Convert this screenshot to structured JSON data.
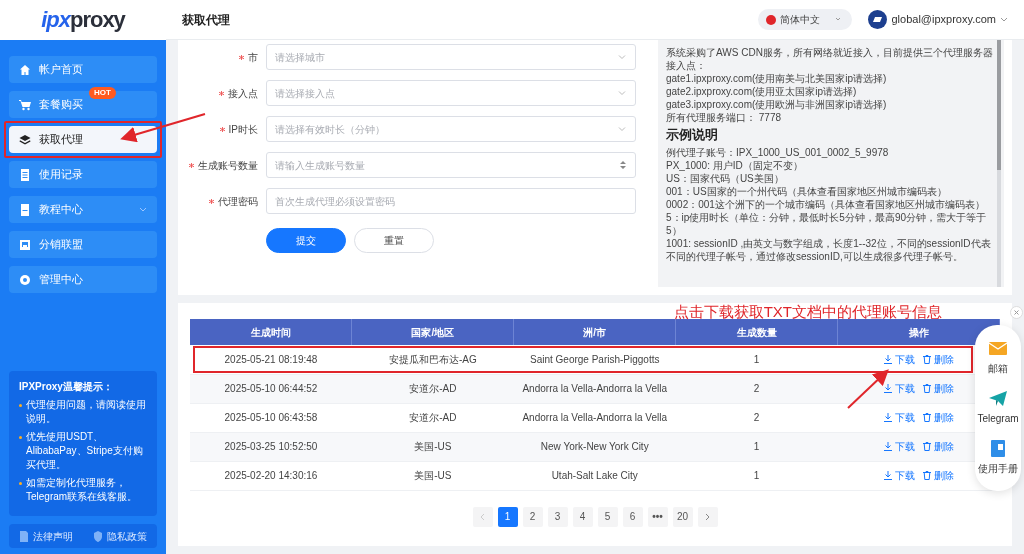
{
  "logo": {
    "mark": "ipx",
    "name": "proxy"
  },
  "sidebar": {
    "items": [
      {
        "label": "帐户首页",
        "selected": false,
        "annotated": false,
        "has_submenu": false
      },
      {
        "label": "套餐购买",
        "selected": false,
        "annotated": false,
        "has_submenu": false,
        "badge": "HOT"
      },
      {
        "label": "获取代理",
        "selected": true,
        "annotated": true,
        "has_submenu": false
      },
      {
        "label": "使用记录",
        "selected": false,
        "annotated": false,
        "has_submenu": false
      },
      {
        "label": "教程中心",
        "selected": false,
        "annotated": false,
        "has_submenu": true
      },
      {
        "label": "分销联盟",
        "selected": false,
        "annotated": false,
        "has_submenu": false
      },
      {
        "label": "管理中心",
        "selected": false,
        "annotated": false,
        "has_submenu": false
      }
    ],
    "tips": {
      "title": "IPXProxy温馨提示：",
      "items": [
        "代理使用问题，请阅读使用说明。",
        "优先使用USDT、AlibabaPay、Stripe支付购买代理。",
        "如需定制化代理服务，Telegram联系在线客服。"
      ]
    },
    "footer_links": [
      "法律声明",
      "隐私政策"
    ]
  },
  "header": {
    "title": "获取代理",
    "language": "简体中文",
    "user": "global@ipxproxy.com"
  },
  "form": {
    "fields": [
      {
        "label": "市",
        "required": true,
        "kind": "select",
        "placeholder": "请选择城市"
      },
      {
        "label": "接入点",
        "required": true,
        "kind": "select",
        "placeholder": "请选择接入点"
      },
      {
        "label": "IP时长",
        "required": true,
        "kind": "select",
        "placeholder": "请选择有效时长（分钟）"
      },
      {
        "label": "生成账号数量",
        "required": true,
        "kind": "number",
        "placeholder": "请输入生成账号数量"
      },
      {
        "label": "代理密码",
        "required": true,
        "kind": "text",
        "placeholder": "首次生成代理必须设置密码"
      }
    ],
    "buttons": [
      {
        "label": "提交",
        "primary": true
      },
      {
        "label": "重置",
        "primary": false
      }
    ]
  },
  "info": {
    "lines": [
      "系统采购了AWS CDN服务，所有网络就近接入，目前提供三个代理服务器接入点：",
      "gate1.ipxproxy.com(使用南美与北美国家ip请选择)",
      "gate2.ipxproxy.com(使用亚太国家ip请选择)",
      "gate3.ipxproxy.com(使用欧洲与非洲国家ip请选择)",
      "所有代理服务端口： 7778"
    ],
    "heading": "示例说明",
    "example_lines": [
      "例代理子账号：IPX_1000_US_001_0002_5_9978",
      "PX_1000: 用户ID（固定不变）",
      "US：国家代码（US美国）",
      "001：US国家的一个州代码（具体查看国家地区州城市编码表）",
      "0002：001这个洲下的一个城市编码（具体查看国家地区州城市编码表）",
      "5：ip使用时长（单位：分钟，最低时长5分钟，最高90分钟，需大于等于5）",
      "1001: sessionID ,由英文与数字组成，长度1--32位，不同的sessionID代表不同的代理子帐号，通过修改sessionID,可以生成很多代理子帐号。"
    ]
  },
  "annotation": {
    "caption": "点击下载获取TXT文档中的代理账号信息"
  },
  "table": {
    "columns": [
      "生成时间",
      "国家/地区",
      "洲/市",
      "生成数量",
      "操作"
    ],
    "rows": [
      {
        "cells": [
          "2025-05-21 08:19:48",
          "安提瓜和巴布达-AG",
          "Saint George Parish-Piggotts",
          "1"
        ],
        "download": "下载",
        "delete": "删除",
        "annotated": true
      },
      {
        "cells": [
          "2025-05-10 06:44:52",
          "安道尔-AD",
          "Andorra la Vella-Andorra la Vella",
          "2"
        ],
        "download": "下载",
        "delete": "删除",
        "annotated": false
      },
      {
        "cells": [
          "2025-05-10 06:43:58",
          "安道尔-AD",
          "Andorra la Vella-Andorra la Vella",
          "2"
        ],
        "download": "下载",
        "delete": "删除",
        "annotated": false
      },
      {
        "cells": [
          "2025-03-25 10:52:50",
          "美国-US",
          "New York-New York City",
          "1"
        ],
        "download": "下载",
        "delete": "删除",
        "annotated": false
      },
      {
        "cells": [
          "2025-02-20 14:30:16",
          "美国-US",
          "Utah-Salt Lake City",
          "1"
        ],
        "download": "下载",
        "delete": "删除",
        "annotated": false
      }
    ]
  },
  "pagination": {
    "pages": [
      {
        "label": "1",
        "selected": true,
        "kind": "page"
      },
      {
        "label": "2",
        "selected": false,
        "kind": "page"
      },
      {
        "label": "3",
        "selected": false,
        "kind": "page"
      },
      {
        "label": "4",
        "selected": false,
        "kind": "page"
      },
      {
        "label": "5",
        "selected": false,
        "kind": "page"
      },
      {
        "label": "6",
        "selected": false,
        "kind": "page"
      },
      {
        "label": "•••",
        "selected": false,
        "kind": "ellipsis"
      },
      {
        "label": "20",
        "selected": false,
        "kind": "page"
      }
    ]
  },
  "float_panel": {
    "items": [
      {
        "label": "邮箱"
      },
      {
        "label": "Telegram"
      },
      {
        "label": "使用手册"
      }
    ]
  }
}
